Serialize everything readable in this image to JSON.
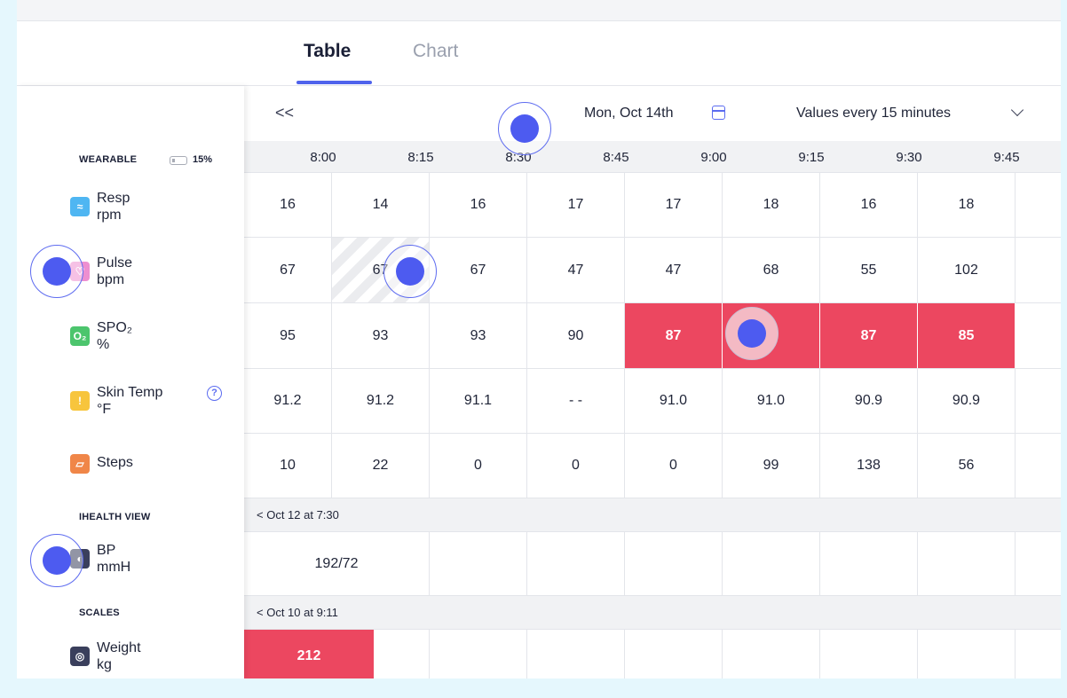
{
  "tabs": {
    "table": "Table",
    "chart": "Chart"
  },
  "toolbar": {
    "collapse": "<<",
    "date": "Mon, Oct 14th",
    "interval": "Values every 15 minutes"
  },
  "time_axis": [
    "8:00",
    "8:15",
    "8:30",
    "8:45",
    "9:00",
    "9:15",
    "9:30",
    "9:45"
  ],
  "sidebar": {
    "wearable_label": "WEARABLE",
    "battery_pct": "15%",
    "ihealth_label": "IHEALTH VIEW",
    "scales_label": "SCALES",
    "metrics": {
      "resp": {
        "name": "Resp",
        "unit": "rpm",
        "icon": "lungs-icon",
        "color": "#4fb6f2"
      },
      "pulse": {
        "name": "Pulse",
        "unit": "bpm",
        "icon": "heart-icon",
        "color": "#ee8fd0"
      },
      "spo2": {
        "name": "SPO₂",
        "unit": "%",
        "icon": "oxygen-icon",
        "icon_text": "O₂",
        "color": "#4cc56d"
      },
      "skin": {
        "name": "Skin Temp",
        "unit": "°F",
        "icon": "thermometer-icon",
        "color": "#f7c53d",
        "help": "?"
      },
      "steps": {
        "name": "Steps",
        "unit": "",
        "icon": "shoe-icon",
        "color": "#f08648"
      },
      "bp": {
        "name": "BP",
        "unit": "mmH",
        "icon": "blood-pressure-icon",
        "color": "#3a3f5c"
      },
      "weight": {
        "name": "Weight",
        "unit": "kg",
        "icon": "scale-icon",
        "color": "#3a3f5c"
      }
    }
  },
  "table": {
    "resp": [
      "16",
      "14",
      "16",
      "17",
      "17",
      "18",
      "16",
      "18"
    ],
    "pulse": [
      "67",
      "67",
      "67",
      "47",
      "47",
      "68",
      "55",
      "102"
    ],
    "spo2": [
      "95",
      "93",
      "93",
      "90",
      "87",
      "",
      "87",
      "85"
    ],
    "skin": [
      "91.2",
      "91.2",
      "91.1",
      "- -",
      "91.0",
      "91.0",
      "90.9",
      "90.9"
    ],
    "steps": [
      "10",
      "22",
      "0",
      "0",
      "0",
      "99",
      "138",
      "56"
    ],
    "bp_header": "< Oct 12 at 7:30",
    "bp_value": "192/72",
    "weight_header": "< Oct 10 at 9:11",
    "weight_value": "212"
  },
  "colors": {
    "accent": "#4f63ec",
    "alert": "#ec4760"
  }
}
